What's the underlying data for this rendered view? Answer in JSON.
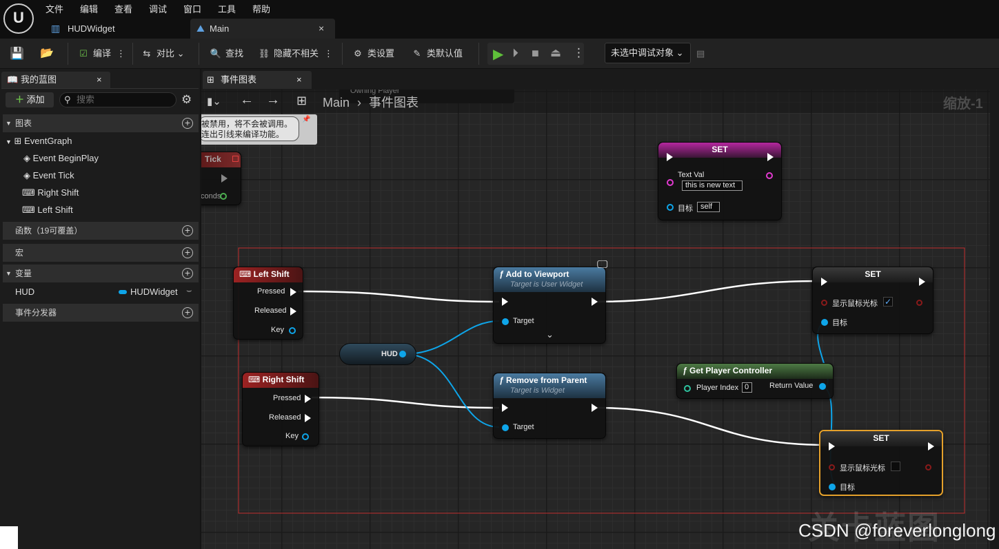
{
  "menu": [
    "文件",
    "编辑",
    "查看",
    "调试",
    "窗口",
    "工具",
    "帮助"
  ],
  "tabs": [
    {
      "label": "HUDWidget"
    },
    {
      "label": "Main"
    }
  ],
  "toolbar": {
    "compile": "编译",
    "diff": "对比",
    "find": "查找",
    "hide_unrelated": "隐藏不相关",
    "class_settings": "类设置",
    "class_defaults": "类默认值",
    "debug_target": "未选中调试对象"
  },
  "my_blueprint": {
    "tab_title": "我的蓝图",
    "add_label": "添加",
    "search_placeholder": "搜索",
    "sections": {
      "graphs": "图表",
      "functions": "函数（19可覆盖）",
      "macros": "宏",
      "variables": "变量",
      "dispatchers": "事件分发器"
    },
    "graph_items": [
      "EventGraph",
      "Event BeginPlay",
      "Event Tick",
      "Right Shift",
      "Left Shift"
    ],
    "variable": {
      "name": "HUD",
      "type": "HUDWidget"
    }
  },
  "graph": {
    "tab_title": "事件图表",
    "breadcrumb_root": "Main",
    "breadcrumb_leaf": "事件图表",
    "zoom": "缩放-1",
    "owning_player": "Owning Player",
    "disabled_note_1": "被禁用，将不会被调用。",
    "disabled_note_2": "连出引线来编译功能。",
    "tick_node": {
      "title": "Tick",
      "pin": "conds"
    },
    "set_text": {
      "title": "SET",
      "text_val_label": "Text Val",
      "text_val": "this is new text",
      "target_label": "目标",
      "target_val": "self"
    },
    "left_shift": {
      "title": "Left Shift",
      "pressed": "Pressed",
      "released": "Released",
      "key": "Key"
    },
    "right_shift": {
      "title": "Right Shift",
      "pressed": "Pressed",
      "released": "Released",
      "key": "Key"
    },
    "hud_var": "HUD",
    "add_viewport": {
      "title": "Add to Viewport",
      "subtitle": "Target is User Widget",
      "target": "Target",
      "expand": "⌄"
    },
    "remove_parent": {
      "title": "Remove from Parent",
      "subtitle": "Target is Widget",
      "target": "Target"
    },
    "get_pc": {
      "title": "Get Player Controller",
      "player_index": "Player Index",
      "index_val": "0",
      "return": "Return Value"
    },
    "set_show_true": {
      "title": "SET",
      "label": "显示鼠标光标",
      "check": "✓",
      "target": "目标"
    },
    "set_show_false": {
      "title": "SET",
      "label": "显示鼠标光标",
      "target": "目标"
    }
  },
  "watermark": {
    "faint": "关卡蓝图",
    "credit": "CSDN @foreverlonglong"
  },
  "colors": {
    "accent_blue": "#0ea5e9",
    "event_red": "#8e1d1d",
    "func_blue": "#3a6a8c",
    "pure_green": "#3f6e3a",
    "set_magenta": "#a1208f",
    "selected_orange": "#e5a12b",
    "comment_red": "#c22d2d"
  }
}
